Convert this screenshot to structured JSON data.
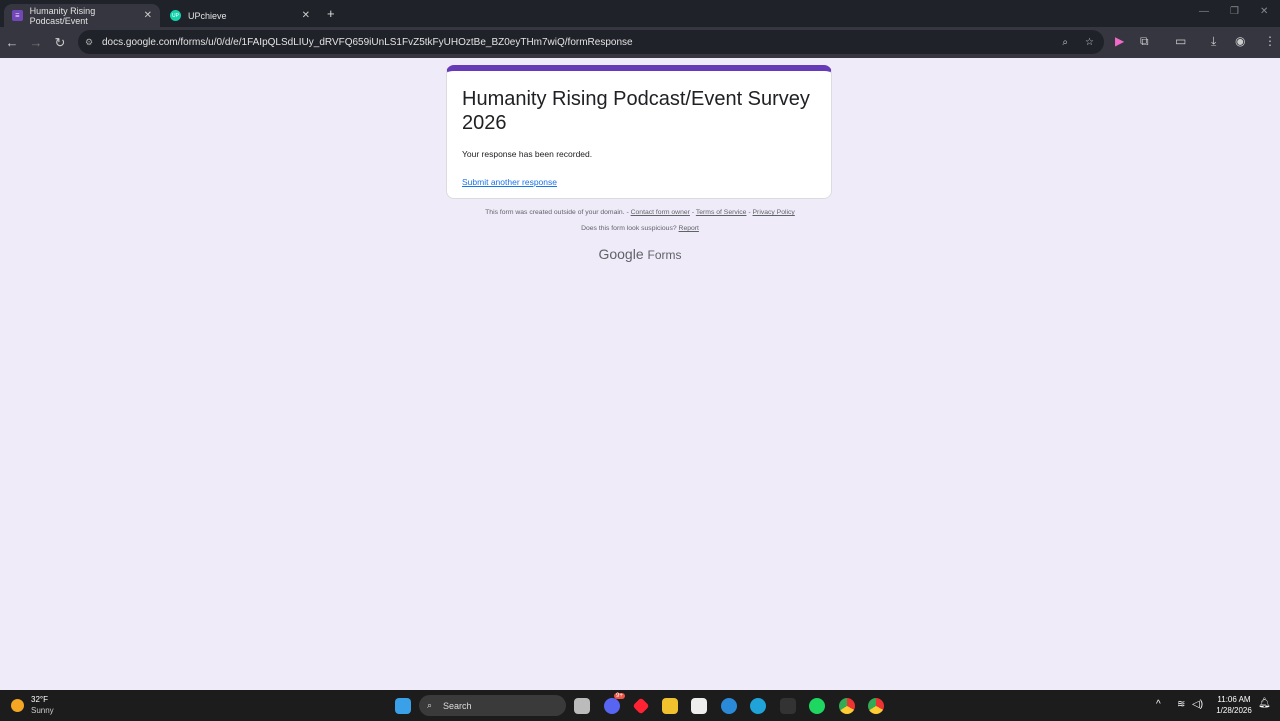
{
  "browser": {
    "tabs": [
      {
        "title": "Humanity Rising Podcast/Event",
        "active": true
      },
      {
        "title": "UPchieve",
        "active": false
      }
    ],
    "url": "docs.google.com/forms/u/0/d/e/1FAIpQLSdLIUy_dRVFQ659iUnLS1FvZ5tkFyUHOztBe_BZ0eyTHm7wiQ/formResponse"
  },
  "form": {
    "title": "Humanity Rising Podcast/Event Survey 2026",
    "message": "Your response has been recorded.",
    "submit_another": "Submit another response",
    "accent": "#673ab7"
  },
  "footer": {
    "created_outside": "This form was created outside of your domain. -",
    "contact": "Contact form owner",
    "sep": "-",
    "terms": "Terms of Service",
    "privacy": "Privacy Policy",
    "suspicious": "Does this form look suspicious?",
    "report": "Report",
    "brand_google": "Google",
    "brand_forms": "Forms"
  },
  "taskbar": {
    "weather_temp": "32°F",
    "weather_desc": "Sunny",
    "search": "Search",
    "time": "11:06 AM",
    "date": "1/28/2026",
    "discord_badge": "9+"
  }
}
